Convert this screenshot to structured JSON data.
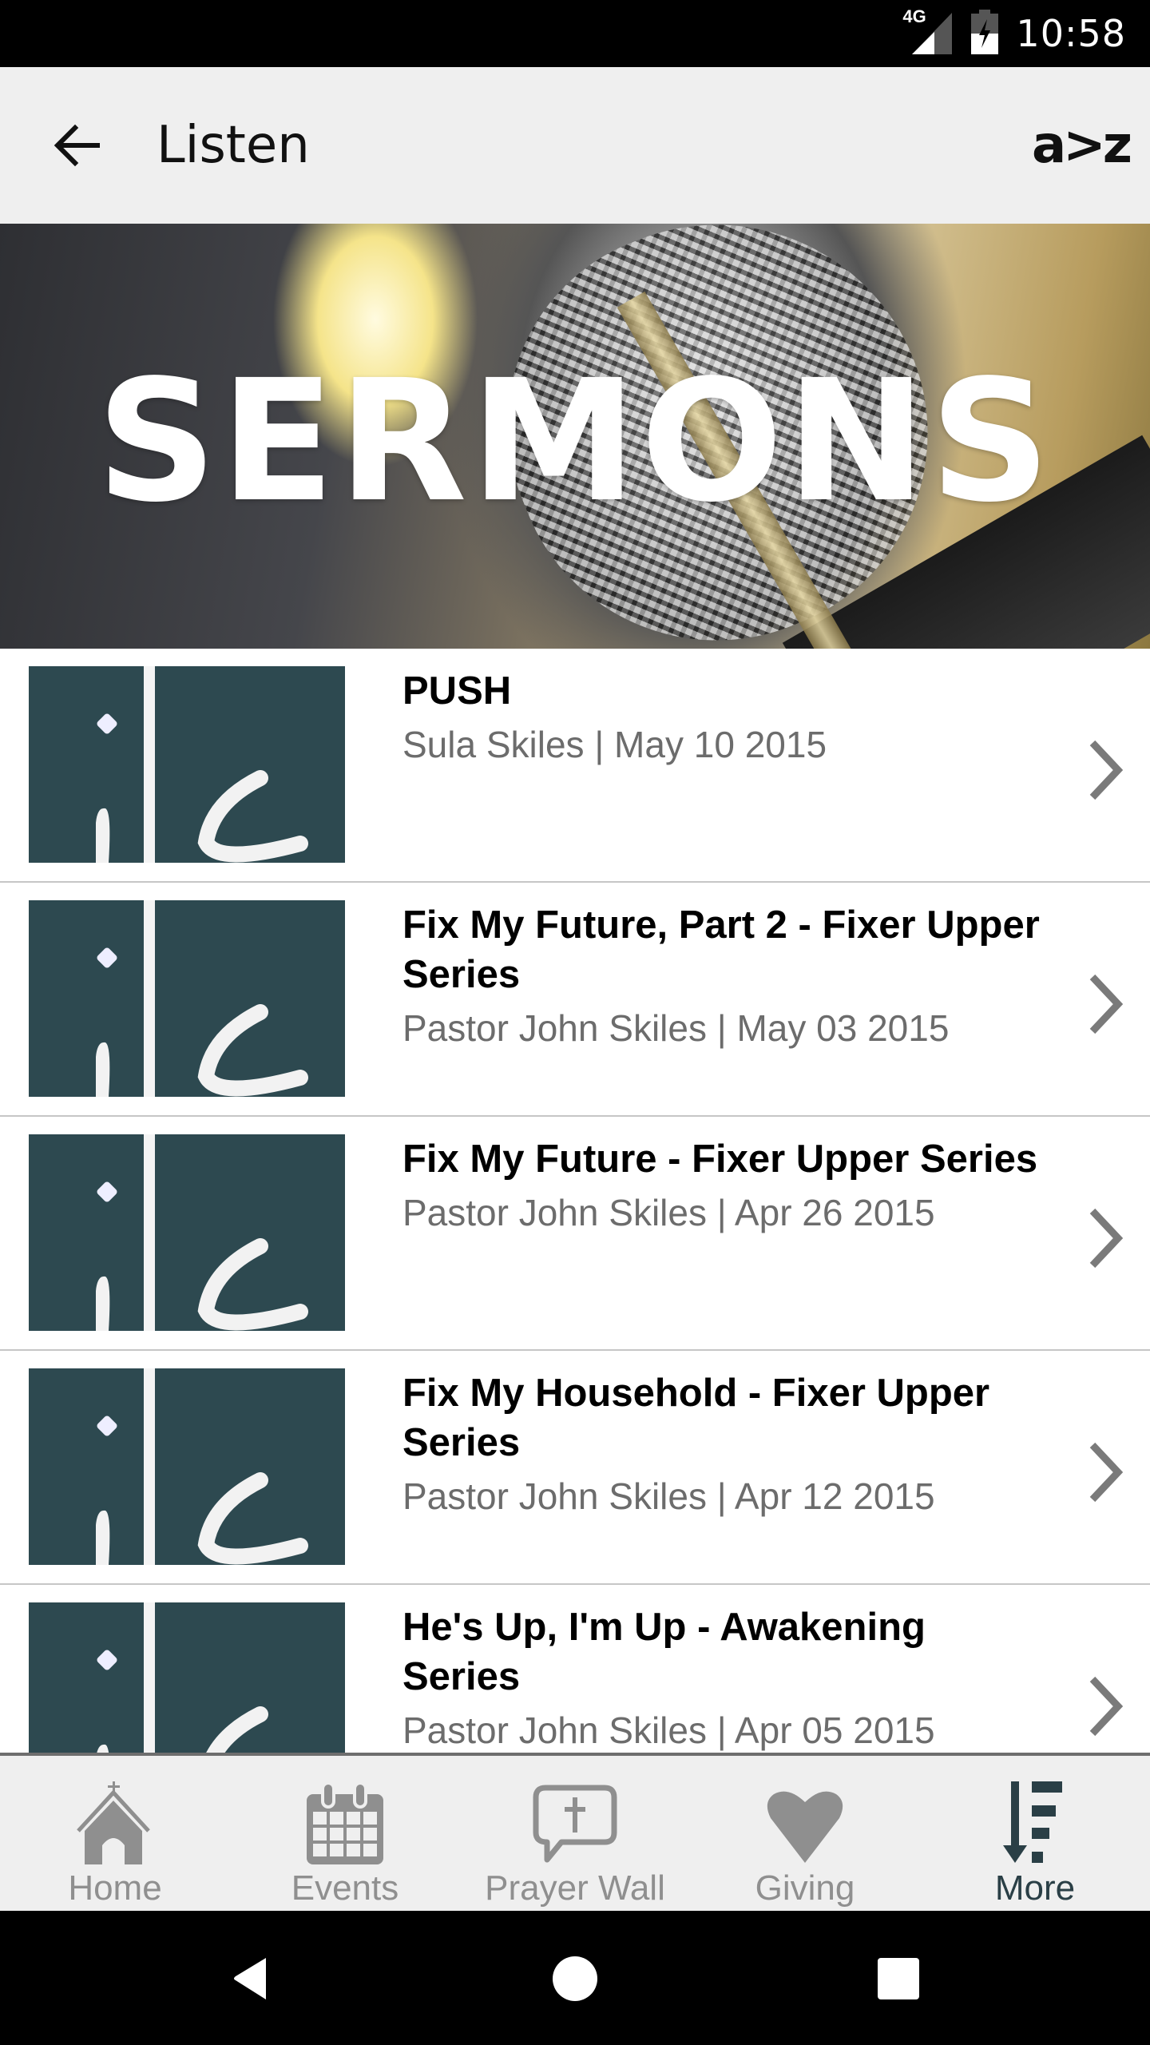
{
  "status_bar": {
    "network": "4G",
    "time": "10:58",
    "icons": [
      "signal-icon",
      "battery-charging-icon"
    ]
  },
  "app_bar": {
    "back_icon": "arrow-left-icon",
    "title": "Listen",
    "sort_label": "a>z"
  },
  "banner": {
    "title": "SERMONS",
    "image": "microphone-photo"
  },
  "sermons": [
    {
      "title": "PUSH",
      "subtitle": "Sula Skiles | May 10 2015"
    },
    {
      "title": "Fix My Future, Part 2 - Fixer Upper Series",
      "subtitle": "Pastor John Skiles | May 03 2015"
    },
    {
      "title": "Fix My Future - Fixer Upper Series",
      "subtitle": "Pastor John Skiles | Apr 26 2015"
    },
    {
      "title": "Fix My Household - Fixer Upper Series",
      "subtitle": "Pastor John Skiles | Apr 12 2015"
    },
    {
      "title": "He's Up, I'm Up - Awakening Series",
      "subtitle": "Pastor John Skiles | Apr 05 2015"
    }
  ],
  "bottom_nav": {
    "items": [
      {
        "label": "Home",
        "icon": "church-icon",
        "active": false
      },
      {
        "label": "Events",
        "icon": "calendar-icon",
        "active": false
      },
      {
        "label": "Prayer Wall",
        "icon": "prayer-bubble-icon",
        "active": false
      },
      {
        "label": "Giving",
        "icon": "heart-icon",
        "active": false
      },
      {
        "label": "More",
        "icon": "more-list-icon",
        "active": true
      }
    ]
  },
  "system_nav": {
    "buttons": [
      "back-triangle-icon",
      "home-circle-icon",
      "recents-square-icon"
    ]
  },
  "colors": {
    "accent": "#2a3f46",
    "thumb_bg": "#2d4950",
    "inactive": "#8f8f8f",
    "subtitle": "#6c6c6c",
    "bar_bg": "#efefef"
  }
}
